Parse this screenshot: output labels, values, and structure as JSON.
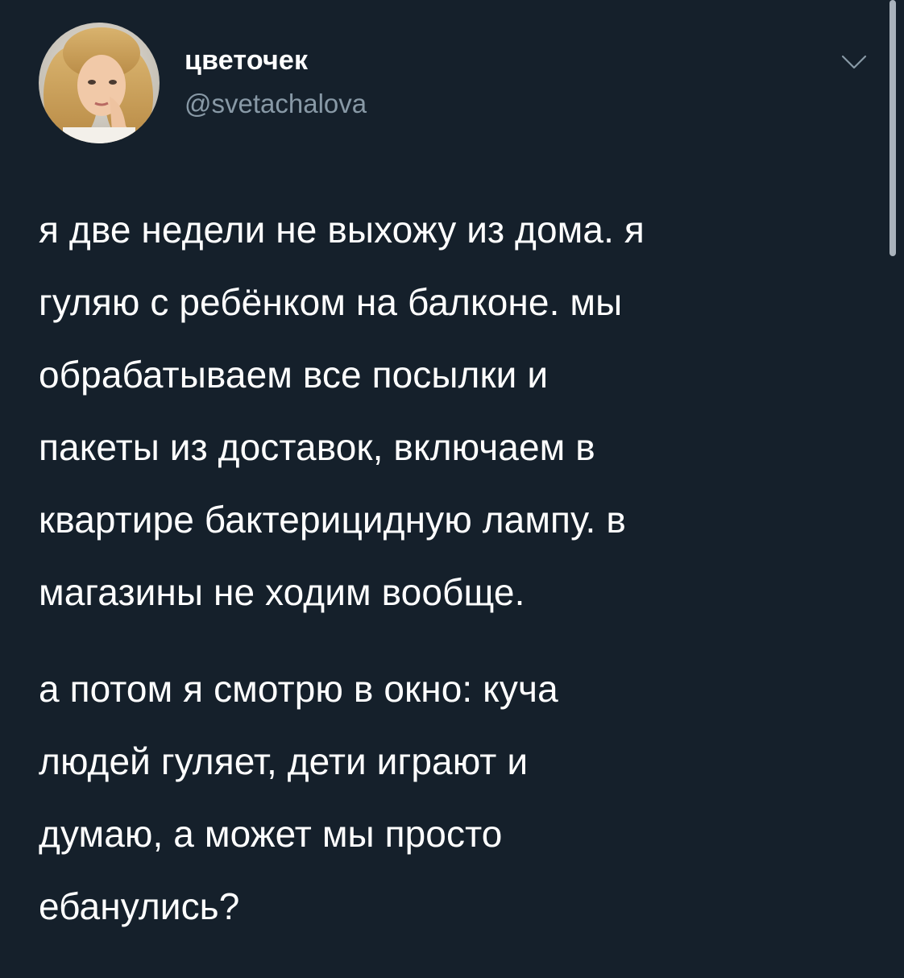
{
  "user": {
    "display_name": "цветочек",
    "handle": "@svetachalova",
    "avatar": "avatar-photo"
  },
  "menu": {
    "icon": "chevron-down-icon"
  },
  "tweet": {
    "paragraphs": [
      {
        "lines": [
          "я две недели не выхожу из дома. я",
          "гуляю с ребёнком на балконе. мы",
          "обрабатываем все посылки и",
          "пакеты из доставок, включаем в",
          "квартире бактерицидную лампу. в",
          "магазины не ходим вообще."
        ]
      },
      {
        "lines": [
          "а потом я смотрю в окно: куча",
          "людей гуляет, дети играют и",
          "думаю, а может мы просто",
          "ебанулись?"
        ]
      }
    ]
  },
  "colors": {
    "background": "#15202b",
    "text_primary": "#ffffff",
    "text_secondary": "#8899a6"
  }
}
